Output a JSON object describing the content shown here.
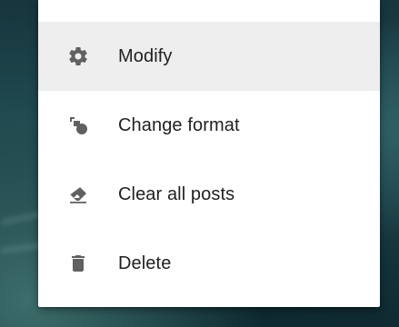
{
  "menu": {
    "items": [
      {
        "label": "Modify",
        "icon": "gear-icon",
        "selected": true
      },
      {
        "label": "Change format",
        "icon": "shapes-icon",
        "selected": false
      },
      {
        "label": "Clear all posts",
        "icon": "eraser-icon",
        "selected": false
      },
      {
        "label": "Delete",
        "icon": "trash-icon",
        "selected": false
      }
    ]
  },
  "colors": {
    "icon": "#616161",
    "text": "#212121",
    "selected_background": "#eeeeee",
    "menu_background": "#ffffff"
  }
}
